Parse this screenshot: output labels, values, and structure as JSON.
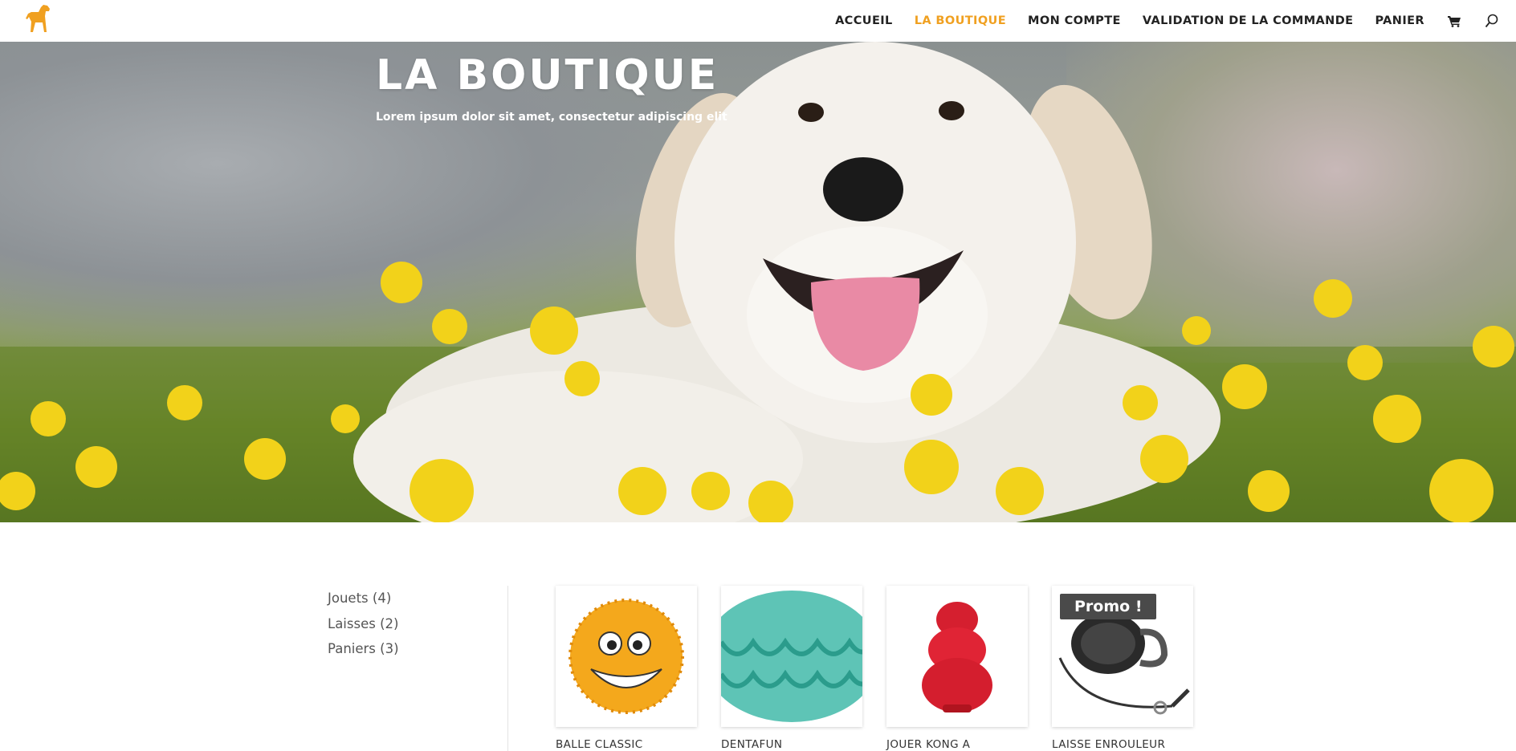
{
  "header": {
    "logo_icon": "dog-silhouette-icon",
    "nav": [
      {
        "label": "ACCUEIL",
        "active": false
      },
      {
        "label": "LA BOUTIQUE",
        "active": true
      },
      {
        "label": "MON COMPTE",
        "active": false
      },
      {
        "label": "VALIDATION DE LA COMMANDE",
        "active": false
      },
      {
        "label": "PANIER",
        "active": false
      }
    ],
    "cart_icon": "cart-icon",
    "search_icon": "search-icon",
    "accent_color": "#f0a020"
  },
  "hero": {
    "title": "LA BOUTIQUE",
    "subtitle": "Lorem ipsum dolor sit amet, consectetur adipiscing elit"
  },
  "sidebar": {
    "categories": [
      {
        "label": "Jouets (4)"
      },
      {
        "label": "Laisses (2)"
      },
      {
        "label": "Paniers (3)"
      }
    ]
  },
  "products": [
    {
      "name": "BALLE CLASSIC",
      "image": "smiley-ball-toy",
      "promo": false
    },
    {
      "name": "DENTAFUN",
      "image": "teal-rubber-ball",
      "promo": false
    },
    {
      "name": "JOUER KONG A",
      "image": "red-kong-toy",
      "promo": false
    },
    {
      "name": "LAISSE ENROULEUR",
      "image": "retractable-leash",
      "promo": true,
      "promo_label": "Promo !"
    }
  ]
}
